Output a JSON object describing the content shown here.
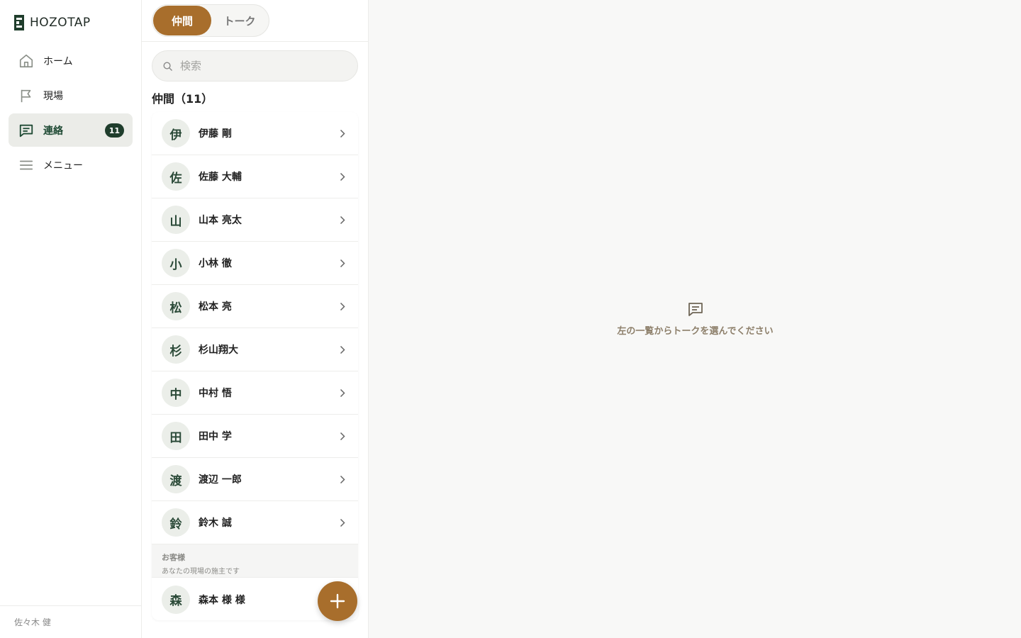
{
  "brand": {
    "name": "HOZOTAP"
  },
  "nav": {
    "items": [
      {
        "label": "ホーム",
        "icon": "home-icon"
      },
      {
        "label": "現場",
        "icon": "flag-icon"
      },
      {
        "label": "連絡",
        "icon": "chat-icon",
        "badge": "11",
        "active": true
      },
      {
        "label": "メニュー",
        "icon": "menu-icon"
      }
    ],
    "footer_user": "佐々木 健"
  },
  "contacts": {
    "tabs": [
      {
        "label": "仲間",
        "active": true
      },
      {
        "label": "トーク",
        "active": false
      }
    ],
    "search_placeholder": "検索",
    "section_title": "仲間（11）",
    "members": [
      {
        "initial": "伊",
        "name": "伊藤 剛"
      },
      {
        "initial": "佐",
        "name": "佐藤 大輔"
      },
      {
        "initial": "山",
        "name": "山本 亮太"
      },
      {
        "initial": "小",
        "name": "小林 徹"
      },
      {
        "initial": "松",
        "name": "松本 亮"
      },
      {
        "initial": "杉",
        "name": "杉山翔大"
      },
      {
        "initial": "中",
        "name": "中村 悟"
      },
      {
        "initial": "田",
        "name": "田中 学"
      },
      {
        "initial": "渡",
        "name": "渡辺 一郎"
      },
      {
        "initial": "鈴",
        "name": "鈴木 誠"
      }
    ],
    "customer_section": {
      "title": "お客様",
      "subtitle": "あなたの現場の施主です"
    },
    "customers": [
      {
        "initial": "森",
        "name": "森本 様 様"
      }
    ]
  },
  "main": {
    "empty_message": "左の一覧からトークを選んでください"
  },
  "colors": {
    "accent": "#a86e2c",
    "brand_dark": "#1f3d2c",
    "active_bg": "#ebece8"
  }
}
